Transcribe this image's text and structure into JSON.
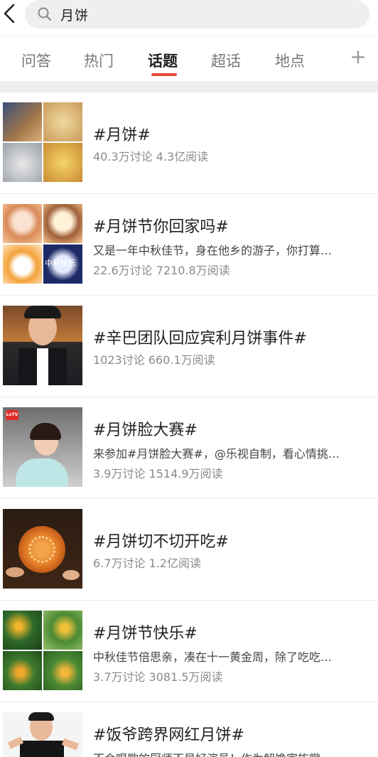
{
  "search": {
    "query": "月饼",
    "icons": {
      "back": "back-arrow-icon",
      "search": "search-icon"
    }
  },
  "tabs": [
    {
      "label": "问答",
      "active": false
    },
    {
      "label": "热门",
      "active": false
    },
    {
      "label": "话题",
      "active": true
    },
    {
      "label": "超话",
      "active": false
    },
    {
      "label": "地点",
      "active": false
    }
  ],
  "tabs_more": {
    "icon": "plus-icon",
    "label": "+"
  },
  "accent_color": "#e7453a",
  "topics": [
    {
      "title": "#月饼#",
      "desc": "",
      "stats": "40.3万讨论 4.3亿阅读",
      "thumb_label": ""
    },
    {
      "title": "#月饼节你回家吗#",
      "desc": "又是一年中秋佳节，身在他乡的游子，你打算…",
      "stats": "22.6万讨论 7210.8万阅读",
      "thumb_label": "中秋快乐"
    },
    {
      "title": "#辛巴团队回应宾利月饼事件#",
      "desc": "",
      "stats": "1023讨论 660.1万阅读",
      "thumb_label": ""
    },
    {
      "title": "#月饼脸大赛#",
      "desc": "来参加#月饼脸大赛#，@乐视自制，看心情挑…",
      "stats": "3.9万讨论 1514.9万阅读",
      "thumb_label": "LeTV"
    },
    {
      "title": "#月饼切不切开吃#",
      "desc": "",
      "stats": "6.7万讨论 1.2亿阅读",
      "thumb_label": ""
    },
    {
      "title": "#月饼节快乐#",
      "desc": "中秋佳节倍思亲，凑在十一黄金周，除了吃吃…",
      "stats": "3.7万讨论 3081.5万阅读",
      "thumb_label": ""
    },
    {
      "title": "#饭爷跨界网红月饼#",
      "desc": "不会唱歌的厨师不是好演员！作为解馋家族掌…",
      "stats": "",
      "thumb_label": ""
    }
  ]
}
